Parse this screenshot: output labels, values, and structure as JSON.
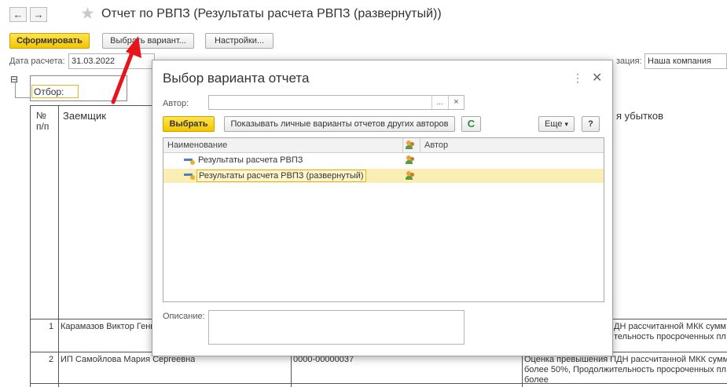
{
  "window": {
    "back_icon": "←",
    "forward_icon": "→",
    "favorite_icon": "★",
    "title": "Отчет по РВПЗ (Результаты расчета РВПЗ (развернутый))"
  },
  "toolbar": {
    "generate_label": "Сформировать",
    "choose_variant_label": "Выбрать вариант...",
    "settings_label": "Настройки..."
  },
  "params": {
    "date_label": "Дата расчета:",
    "date_value": "31.03.2022",
    "org_label": "зация:",
    "org_value": "Наша компания"
  },
  "report": {
    "collapse_icon": "⊟",
    "filter_label": "Отбор:",
    "col_num": "№\nп/п",
    "col_num_l1": "№",
    "col_num_l2": "п/п",
    "col_borrower": "Заемщик",
    "col_losses": "я убытков",
    "rows": [
      {
        "num": "1",
        "borrower": "Карамазов Виктор Генн",
        "note_l1": "ДН рассчитанной МКК сумм",
        "note_l2": "тельность просроченных пл"
      },
      {
        "num": "2",
        "borrower": "ИП Самойлова Мария Сергеевна",
        "contract": "0000-00000037",
        "note_l1": "Оценка превышения ПДН рассчитанной МКК сумм",
        "note_l2": "более 50%, Продолжительность просроченных пл",
        "note_l3": "более"
      }
    ]
  },
  "dialog": {
    "title": "Выбор варианта отчета",
    "more_icon": "⋮",
    "close_icon": "✕",
    "author_label": "Автор:",
    "author_value": "",
    "author_select_icon": "...",
    "author_clear_icon": "×",
    "select_label": "Выбрать",
    "show_others_label": "Показывать личные варианты отчетов других авторов",
    "refresh_icon": "C",
    "more_label": "Еще",
    "more_arrow": "▾",
    "help_label": "?",
    "columns": {
      "name": "Наименование",
      "author": "Автор"
    },
    "variants": [
      {
        "name": "Результаты расчета РВПЗ",
        "selected": false
      },
      {
        "name": "Результаты расчета РВПЗ (развернутый)",
        "selected": true
      }
    ],
    "description_label": "Описание:",
    "description_value": ""
  },
  "colors": {
    "accent_yellow": "#f2c600",
    "selection": "#fbeeb4",
    "arrow_red": "#e8141b"
  }
}
